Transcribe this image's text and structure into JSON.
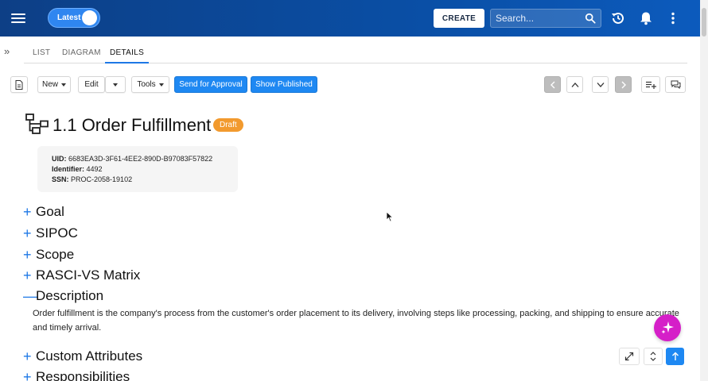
{
  "topbar": {
    "toggle_label": "Latest",
    "create_label": "CREATE",
    "search_placeholder": "Search...",
    "icons": [
      "menu-icon",
      "history-icon",
      "bell-icon",
      "more-vert-icon",
      "search-icon"
    ]
  },
  "tabs": [
    {
      "label": "LIST",
      "active": false
    },
    {
      "label": "DIAGRAM",
      "active": false
    },
    {
      "label": "DETAILS",
      "active": true
    }
  ],
  "toolbar": {
    "new_label": "New",
    "edit_label": "Edit",
    "tools_label": "Tools",
    "send_approval_label": "Send for Approval",
    "show_published_label": "Show Published"
  },
  "page": {
    "title": "1.1 Order Fulfillment",
    "status_badge": "Draft",
    "status_color": "#f29a2e"
  },
  "info": {
    "uid_label": "UID:",
    "uid_value": "6683EA3D-3F61-4EE2-890D-B97083F57822",
    "identifier_label": "Identifier:",
    "identifier_value": "4492",
    "ssn_label": "SSN:",
    "ssn_value": "PROC-2058-19102"
  },
  "sections": [
    {
      "title": "Goal",
      "expanded": false
    },
    {
      "title": "SIPOC",
      "expanded": false
    },
    {
      "title": "Scope",
      "expanded": false
    },
    {
      "title": "RASCI-VS Matrix",
      "expanded": false
    },
    {
      "title": "Description",
      "expanded": true
    },
    {
      "title": "Custom Attributes",
      "expanded": false
    },
    {
      "title": "Responsibilities",
      "expanded": false
    }
  ],
  "description": {
    "text": "Order fulfillment is the company's process from the customer's order placement to its delivery, involving steps like processing, packing, and shipping to ensure accurate and timely arrival."
  },
  "colors": {
    "accent": "#1e78e6",
    "primary_button": "#1e88f2",
    "header": "#0a4fa6",
    "fab": "#d51fc8"
  }
}
